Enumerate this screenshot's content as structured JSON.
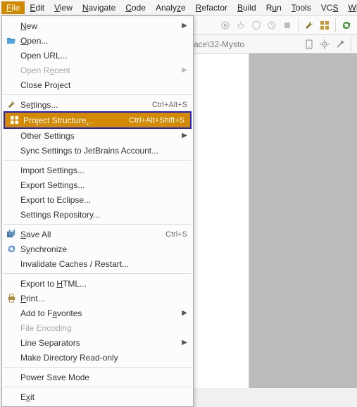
{
  "menubar": {
    "file": "File",
    "edit": "Edit",
    "view": "View",
    "navigate": "Navigate",
    "code": "Code",
    "analyze": "Analyze",
    "refactor": "Refactor",
    "build": "Build",
    "run": "Run",
    "tools": "Tools",
    "vcs": "VCS",
    "window": "Wi"
  },
  "path_fragment": "ace\\32-Mysto",
  "menu": {
    "new": "New",
    "open": "Open...",
    "open_url": "Open URL...",
    "open_recent": "Open Recent",
    "close_project": "Close Project",
    "settings": "Settings...",
    "settings_sc": "Ctrl+Alt+S",
    "project_structure": "Project Structure...",
    "project_structure_sc": "Ctrl+Alt+Shift+S",
    "other_settings": "Other Settings",
    "sync_settings": "Sync Settings to JetBrains Account...",
    "import_settings": "Import Settings...",
    "export_settings": "Export Settings...",
    "export_eclipse": "Export to Eclipse...",
    "settings_repository": "Settings Repository...",
    "save_all": "Save All",
    "save_all_sc": "Ctrl+S",
    "synchronize": "Synchronize",
    "invalidate_caches": "Invalidate Caches / Restart...",
    "export_html": "Export to HTML...",
    "print": "Print...",
    "add_favorites": "Add to Favorites",
    "file_encoding": "File Encoding",
    "line_separators": "Line Separators",
    "make_readonly": "Make Directory Read-only",
    "power_save": "Power Save Mode",
    "exit": "Exit"
  }
}
